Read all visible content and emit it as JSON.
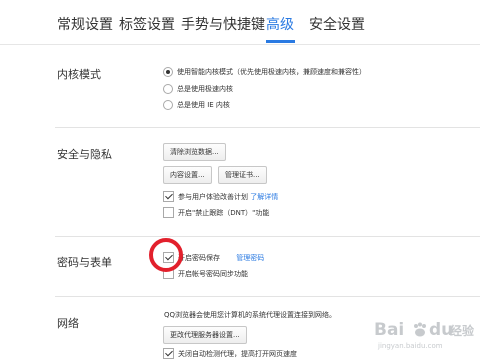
{
  "tabs": [
    {
      "label": "常规设置",
      "active": false
    },
    {
      "label": "标签设置",
      "active": false
    },
    {
      "label": "手势与快捷键",
      "active": false
    },
    {
      "label": "高级",
      "active": true
    },
    {
      "label": "安全设置",
      "active": false
    }
  ],
  "sections": {
    "kernel": {
      "label": "内核模式",
      "options": [
        {
          "text": "使用智能内核模式（优先使用极速内核，兼顾速度和兼容性）",
          "selected": true
        },
        {
          "text": "总是使用极速内核",
          "selected": false
        },
        {
          "text": "总是使用 IE 内核",
          "selected": false
        }
      ]
    },
    "privacy": {
      "label": "安全与隐私",
      "clear_data_button": "清除浏览数据...",
      "content_settings_button": "内容设置...",
      "manage_certs_button": "管理证书...",
      "experience_plan": {
        "text": "参与用户体验改善计划",
        "link": "了解详情",
        "checked": true
      },
      "dnt": {
        "text": "开启\"禁止跟踪（DNT）\"功能",
        "checked": false
      }
    },
    "passwords": {
      "label": "密码与表单",
      "save_passwords": {
        "text": "开启密码保存",
        "link": "管理密码",
        "checked": true
      },
      "sync_passwords": {
        "text": "开启帐号密码同步功能",
        "checked": false
      }
    },
    "network": {
      "label": "网络",
      "description": "QQ浏览器会使用您计算机的系统代理设置连接到网络。",
      "proxy_button": "更改代理服务器设置...",
      "fast_open": {
        "text": "关闭自动检测代理，提高打开网页速度",
        "checked": true
      }
    }
  },
  "watermark": {
    "brand": "Bai",
    "paw": "du",
    "sub": "经验",
    "url": "jingyan.baidu.com"
  },
  "colors": {
    "accent": "#2a7ae2",
    "highlight_circle": "#e2202c"
  }
}
